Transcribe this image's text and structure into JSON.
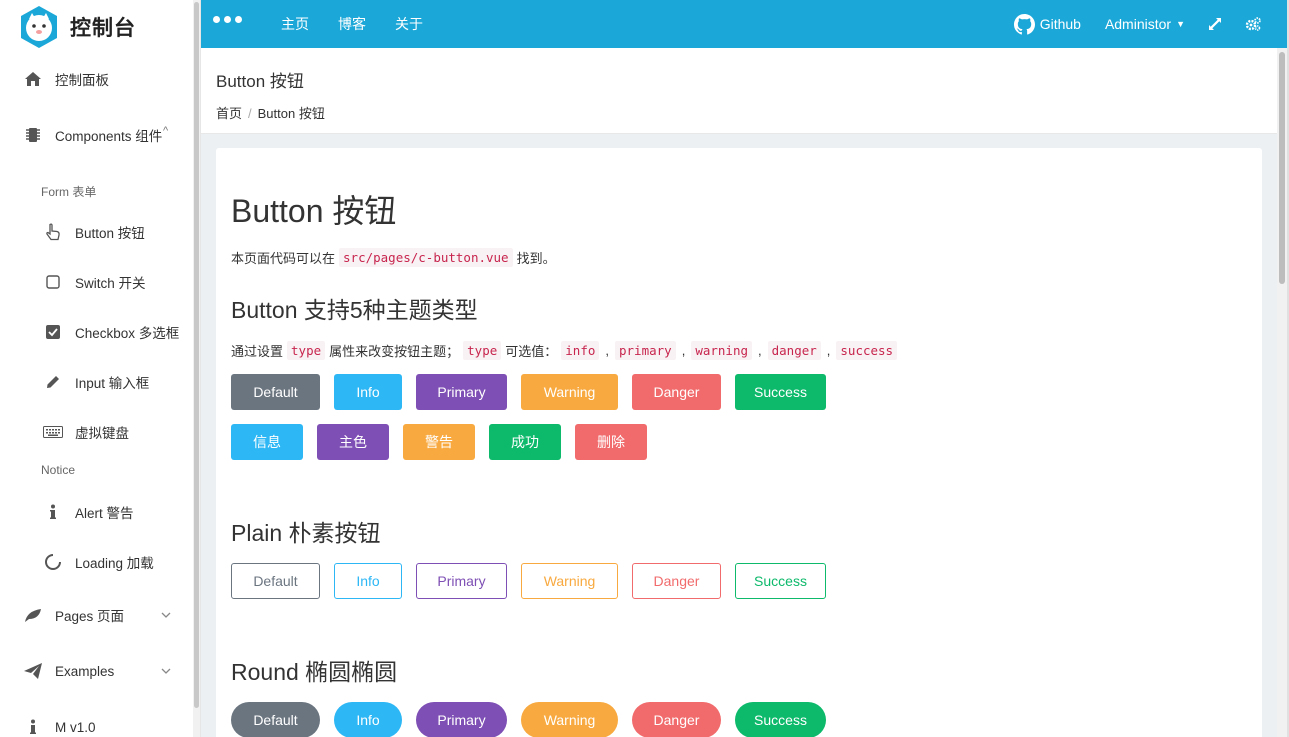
{
  "colors": {
    "topbar": "#1ba8d8",
    "default": "#6b7580",
    "info": "#2db7f5",
    "primary": "#7e4fb4",
    "warning": "#f8a93f",
    "danger": "#f16b6c",
    "success": "#0db96b"
  },
  "sidebar": {
    "brand_title": "控制台",
    "items": [
      {
        "label": "控制面板",
        "icon": "home-icon"
      },
      {
        "label": "Components 组件",
        "icon": "chip-icon"
      },
      {
        "label": "Form 表单"
      },
      {
        "label": "Button 按钮",
        "icon": "pointer-hand-icon"
      },
      {
        "label": "Switch 开关",
        "icon": "square-icon"
      },
      {
        "label": "Checkbox 多选框",
        "icon": "checkbox-icon"
      },
      {
        "label": "Input 输入框",
        "icon": "pencil-icon"
      },
      {
        "label": "虚拟键盘",
        "icon": "keyboard-icon"
      },
      {
        "label": "Notice"
      },
      {
        "label": "Alert 警告",
        "icon": "info-icon"
      },
      {
        "label": "Loading 加载",
        "icon": "spinner-icon"
      },
      {
        "label": "Pages 页面",
        "icon": "leaf-icon"
      },
      {
        "label": "Examples",
        "icon": "paper-plane-icon"
      },
      {
        "label": "M v1.0",
        "icon": "info-icon"
      }
    ]
  },
  "topbar": {
    "nav": [
      "主页",
      "博客",
      "关于"
    ],
    "github": "Github",
    "user": "Administor"
  },
  "page": {
    "title": "Button 按钮",
    "breadcrumb": [
      "首页",
      "Button 按钮"
    ]
  },
  "content": {
    "h1": "Button 按钮",
    "intro_before": "本页面代码可以在",
    "intro_code": "src/pages/c-button.vue",
    "intro_after": "找到。",
    "section1_title": "Button 支持5种主题类型",
    "desc_before": "通过设置",
    "desc_code1": "type",
    "desc_mid": "属性来改变按钮主题；",
    "desc_code2": "type",
    "desc_mid2": "可选值：",
    "desc_options": [
      "info",
      "primary",
      "warning",
      "danger",
      "success"
    ],
    "desc_sep": ",",
    "buttons_en": [
      "Default",
      "Info",
      "Primary",
      "Warning",
      "Danger",
      "Success"
    ],
    "buttons_cn": [
      "信息",
      "主色",
      "警告",
      "成功",
      "删除"
    ],
    "section2_title": "Plain 朴素按钮",
    "section3_title": "Round 椭圆椭圆"
  }
}
